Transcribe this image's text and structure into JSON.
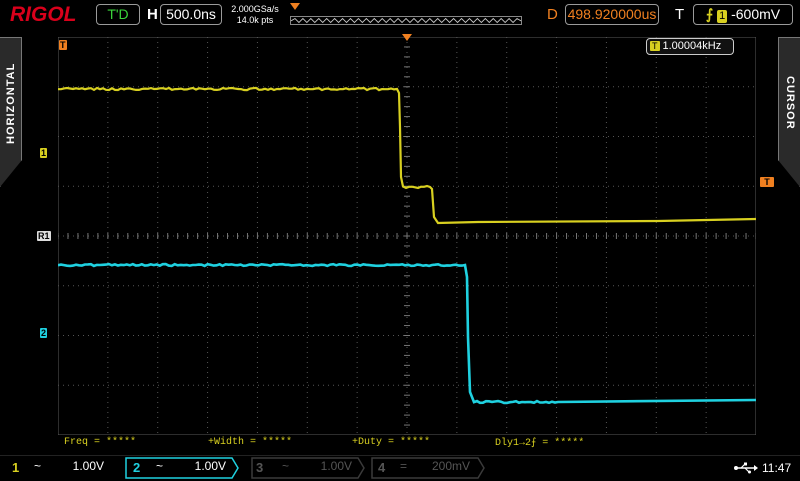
{
  "header": {
    "brand": "RIGOL",
    "run_status": "T'D",
    "timebase_label": "H",
    "timebase": "500.0ns",
    "sample_rate": "2.000GSa/s",
    "memory_depth": "14.0k pts",
    "delay_label": "D",
    "delay": "498.920000us",
    "trigger_label": "T",
    "trigger_channel": "1",
    "trigger_level": "-600mV"
  },
  "side_tabs": {
    "left": "HORIZONTAL",
    "right": "CURSOR"
  },
  "freq_counter": {
    "icon": "T",
    "value": "1.00004kHz"
  },
  "markers": {
    "trigger_pos": "T",
    "ch1": "1",
    "ch2": "2",
    "ref": "R1",
    "trigger_level": "T"
  },
  "measurements": [
    {
      "label": "Freq = *****"
    },
    {
      "label": "+Width = *****"
    },
    {
      "label": "+Duty = *****"
    },
    {
      "label": "Dly1→2⨍ = *****"
    }
  ],
  "channels": [
    {
      "num": "1",
      "coupling": "~",
      "scale": "1.00V",
      "color": "#d8d020",
      "active": true
    },
    {
      "num": "2",
      "coupling": "~",
      "scale": "1.00V",
      "color": "#1fd1e0",
      "active": true
    },
    {
      "num": "3",
      "coupling": "~",
      "scale": "1.00V",
      "color": "#555555",
      "active": false
    },
    {
      "num": "4",
      "coupling": "=",
      "scale": "200mV",
      "color": "#555555",
      "active": false
    }
  ],
  "system": {
    "usb_icon": "usb-icon",
    "time": "11:47"
  },
  "colors": {
    "ch1": "#d8d020",
    "ch2": "#1fd1e0",
    "trigger": "#f08020",
    "grid": "#4a4a4a"
  }
}
